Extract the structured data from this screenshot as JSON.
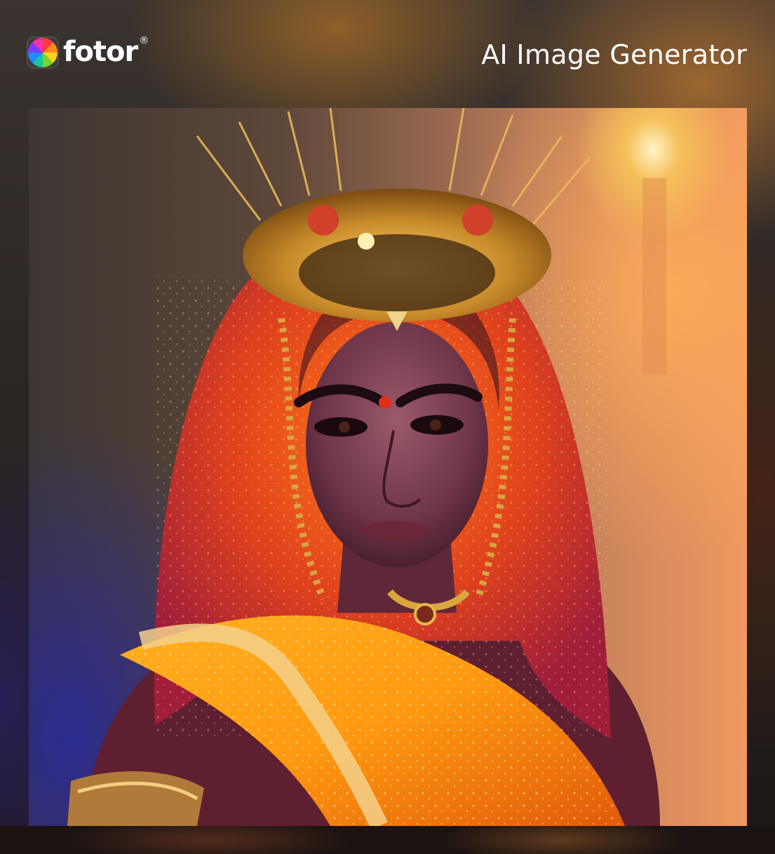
{
  "brand": {
    "name": "fotor",
    "registered_mark": "®",
    "logo_icon": "fotor-petal-logo-icon"
  },
  "header": {
    "title": "AI Image Generator"
  },
  "artwork": {
    "kind": "ai-generated-portrait"
  }
}
